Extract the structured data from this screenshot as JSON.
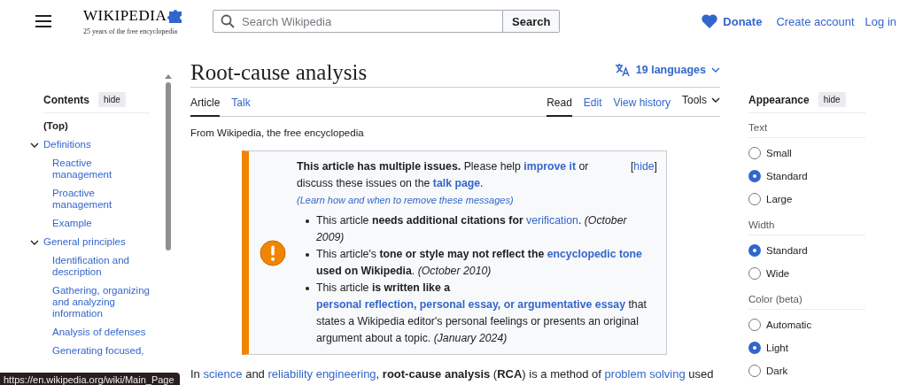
{
  "header": {
    "wordmark": "WIKIPEDIA",
    "tagline": "25 years of the free encyclopedia",
    "search": {
      "placeholder": "Search Wikipedia",
      "button": "Search"
    },
    "donate": "Donate",
    "links": [
      "Create account",
      "Log in"
    ]
  },
  "toc": {
    "title": "Contents",
    "hide": "hide",
    "items": [
      {
        "label": "(Top)",
        "selected": true
      },
      {
        "label": "Definitions",
        "selected": false,
        "expanded": true,
        "children": [
          {
            "label": "Reactive management",
            "selected": false
          },
          {
            "label": "Proactive management",
            "selected": false
          },
          {
            "label": "Example",
            "selected": false
          }
        ]
      },
      {
        "label": "General principles",
        "selected": false,
        "expanded": true,
        "children": [
          {
            "label": "Identification and description",
            "selected": false
          },
          {
            "label": "Gathering, organizing and analyzing information",
            "selected": false
          },
          {
            "label": "Analysis of defenses",
            "selected": false
          },
          {
            "label": "Generating focused,",
            "selected": false
          }
        ]
      }
    ]
  },
  "article": {
    "title": "Root-cause analysis",
    "languages": "19 languages",
    "tabs_left": [
      {
        "label": "Article",
        "selected": true
      },
      {
        "label": "Talk",
        "selected": false
      }
    ],
    "tabs_right": [
      {
        "label": "Read",
        "selected": true,
        "kind": "tab"
      },
      {
        "label": "Edit",
        "selected": false,
        "kind": "tab"
      },
      {
        "label": "View history",
        "selected": false,
        "kind": "tab"
      },
      {
        "label": "Tools",
        "selected": false,
        "kind": "menu"
      }
    ],
    "from": "From Wikipedia, the free encyclopedia",
    "notice": {
      "intro": [
        {
          "kind": "bold",
          "t": "This article has multiple issues."
        },
        {
          "kind": "plain",
          "t": " Please help "
        },
        {
          "kind": "boldlink",
          "t": "improve it"
        },
        {
          "kind": "plain",
          "t": " or discuss these issues on the "
        },
        {
          "kind": "boldlink",
          "t": "talk page"
        },
        {
          "kind": "plain",
          "t": ". "
        },
        {
          "kind": "smalllink",
          "t": "(Learn how and when to remove these messages)"
        }
      ],
      "hide": {
        "open": "[",
        "label": "hide",
        "close": "]"
      },
      "items": [
        [
          {
            "kind": "plain",
            "t": "This article "
          },
          {
            "kind": "bold",
            "t": "needs additional citations for "
          },
          {
            "kind": "link",
            "t": "verification"
          },
          {
            "kind": "plain",
            "t": ". "
          },
          {
            "kind": "italic",
            "t": "(October 2009)"
          }
        ],
        [
          {
            "kind": "plain",
            "t": "This article's "
          },
          {
            "kind": "bold",
            "t": "tone or style may not reflect the "
          },
          {
            "kind": "boldlink",
            "t": "encyclopedic tone"
          },
          {
            "kind": "bold",
            "t": " used on Wikipedia"
          },
          {
            "kind": "plain",
            "t": ". "
          },
          {
            "kind": "italic",
            "t": "(October 2010)"
          }
        ],
        [
          {
            "kind": "plain",
            "t": "This article "
          },
          {
            "kind": "bold",
            "t": "is written like a "
          },
          {
            "kind": "boldlink",
            "t": "personal reflection, personal essay, or argumentative essay"
          },
          {
            "kind": "plain",
            "t": " that states a Wikipedia editor's personal feelings or presents an original argument about a topic. "
          },
          {
            "kind": "italic",
            "t": "(January 2024)"
          }
        ]
      ]
    },
    "paragraph": [
      {
        "kind": "plain",
        "t": "In "
      },
      {
        "kind": "link",
        "t": "science"
      },
      {
        "kind": "plain",
        "t": " and "
      },
      {
        "kind": "link",
        "t": "reliability engineering"
      },
      {
        "kind": "plain",
        "t": ", "
      },
      {
        "kind": "bold",
        "t": "root-cause analysis"
      },
      {
        "kind": "plain",
        "t": " ("
      },
      {
        "kind": "bold",
        "t": "RCA"
      },
      {
        "kind": "plain",
        "t": ") is a method of "
      },
      {
        "kind": "link",
        "t": "problem solving"
      },
      {
        "kind": "plain",
        "t": " used"
      }
    ]
  },
  "appearance": {
    "title": "Appearance",
    "hide": "hide",
    "groups": [
      {
        "label": "Text",
        "options": [
          {
            "label": "Small",
            "selected": false
          },
          {
            "label": "Standard",
            "selected": true
          },
          {
            "label": "Large",
            "selected": false
          }
        ]
      },
      {
        "label": "Width",
        "options": [
          {
            "label": "Standard",
            "selected": true
          },
          {
            "label": "Wide",
            "selected": false
          }
        ]
      },
      {
        "label": "Color (beta)",
        "options": [
          {
            "label": "Automatic",
            "selected": false
          },
          {
            "label": "Light",
            "selected": true
          },
          {
            "label": "Dark",
            "selected": false
          }
        ]
      }
    ]
  },
  "status_url": "https://en.wikipedia.org/wiki/Main_Page"
}
